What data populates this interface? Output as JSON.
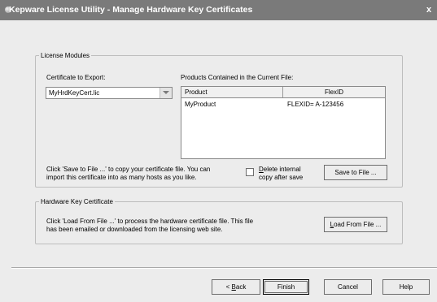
{
  "window": {
    "title": "Kepware License Utility - Manage Hardware Key Certificates",
    "close_label": "x"
  },
  "license_modules": {
    "legend": "License Modules",
    "certificate_label": "Certificate to Export:",
    "certificate_value": "MyHrdKeyCert.lic",
    "products_label": "Products Contained in the Current File:",
    "columns": [
      "Product",
      "FlexID"
    ],
    "rows": [
      {
        "product": "MyProduct",
        "flexid": "FLEXID= A-123456"
      }
    ],
    "save_hint_line1": "Click 'Save to File ...' to copy your certificate file. You can",
    "save_hint_line2": "import this certificate into as many hosts as you like.",
    "delete_label_line1": "Delete internal",
    "delete_label_line2": "copy after save",
    "delete_checked": false,
    "save_button": "Save to File ..."
  },
  "hardware_key": {
    "legend": "Hardware Key Certificate",
    "hint_line1": "Click 'Load From File ...' to process the hardware certificate file. This file",
    "hint_line2": "has been emailed or downloaded from the licensing web site.",
    "load_button": "Load From File ..."
  },
  "footer": {
    "back": "< Back",
    "finish": "Finish",
    "cancel": "Cancel",
    "help": "Help"
  }
}
